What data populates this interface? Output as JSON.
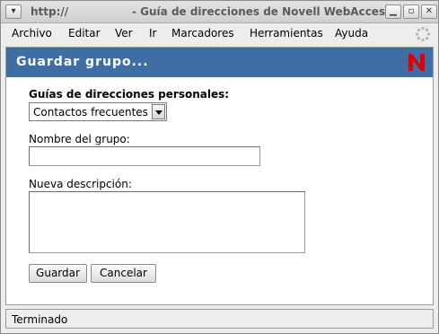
{
  "window": {
    "url": "http://",
    "title": "- Guía de direcciones de Novell WebAccess",
    "menu_icon": "window-menu-icon",
    "minimize_icon": "minimize-icon",
    "maximize_icon": "maximize-icon",
    "close_icon": "close-icon"
  },
  "menubar": {
    "items": [
      {
        "label": "Archivo",
        "accel": "A"
      },
      {
        "label": "Editar",
        "accel": "E"
      },
      {
        "label": "Ver",
        "accel": "V"
      },
      {
        "label": "Ir",
        "accel": "I"
      },
      {
        "label": "Marcadores",
        "accel": "M"
      },
      {
        "label": "Herramientas",
        "accel": "t"
      },
      {
        "label": "Ayuda",
        "accel": "y"
      }
    ],
    "throbber_icon": "loading-throbber-icon"
  },
  "page": {
    "heading": "Guardar grupo...",
    "logo_letter": "N",
    "accent_color": "#3f6ea5",
    "logo_color": "#e00000"
  },
  "form": {
    "addressbook_label": "Guías de direcciones personales:",
    "addressbook_selected": "Contactos frecuentes",
    "group_name_label": "Nombre del grupo:",
    "group_name_value": "",
    "description_label": "Nueva descripción:",
    "description_value": "",
    "save_button": "Guardar",
    "cancel_button": "Cancelar"
  },
  "status": {
    "text": "Terminado"
  }
}
